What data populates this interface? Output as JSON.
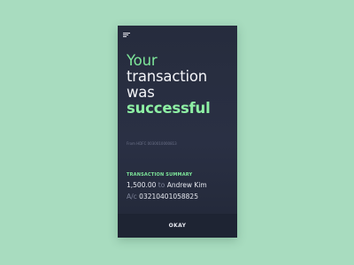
{
  "menu": {
    "icon": "hamburger-menu-icon"
  },
  "headline": {
    "line1": "Your",
    "line2": "transaction",
    "line3": "was",
    "line4": "successful"
  },
  "from_account": "From HDFC 0030010000813",
  "summary": {
    "heading": "TRANSACTION SUMMARY",
    "amount": "1,500.00",
    "to_word": "to",
    "recipient": "Andrew Kim",
    "account_prefix": "A/c",
    "account_number": "03210401058825"
  },
  "footer": {
    "okay_label": "OKAY"
  },
  "colors": {
    "background": "#a8dcbf",
    "card": "#262c3d",
    "accent_green": "#7ee79a",
    "footer_bar": "#1e2433"
  }
}
